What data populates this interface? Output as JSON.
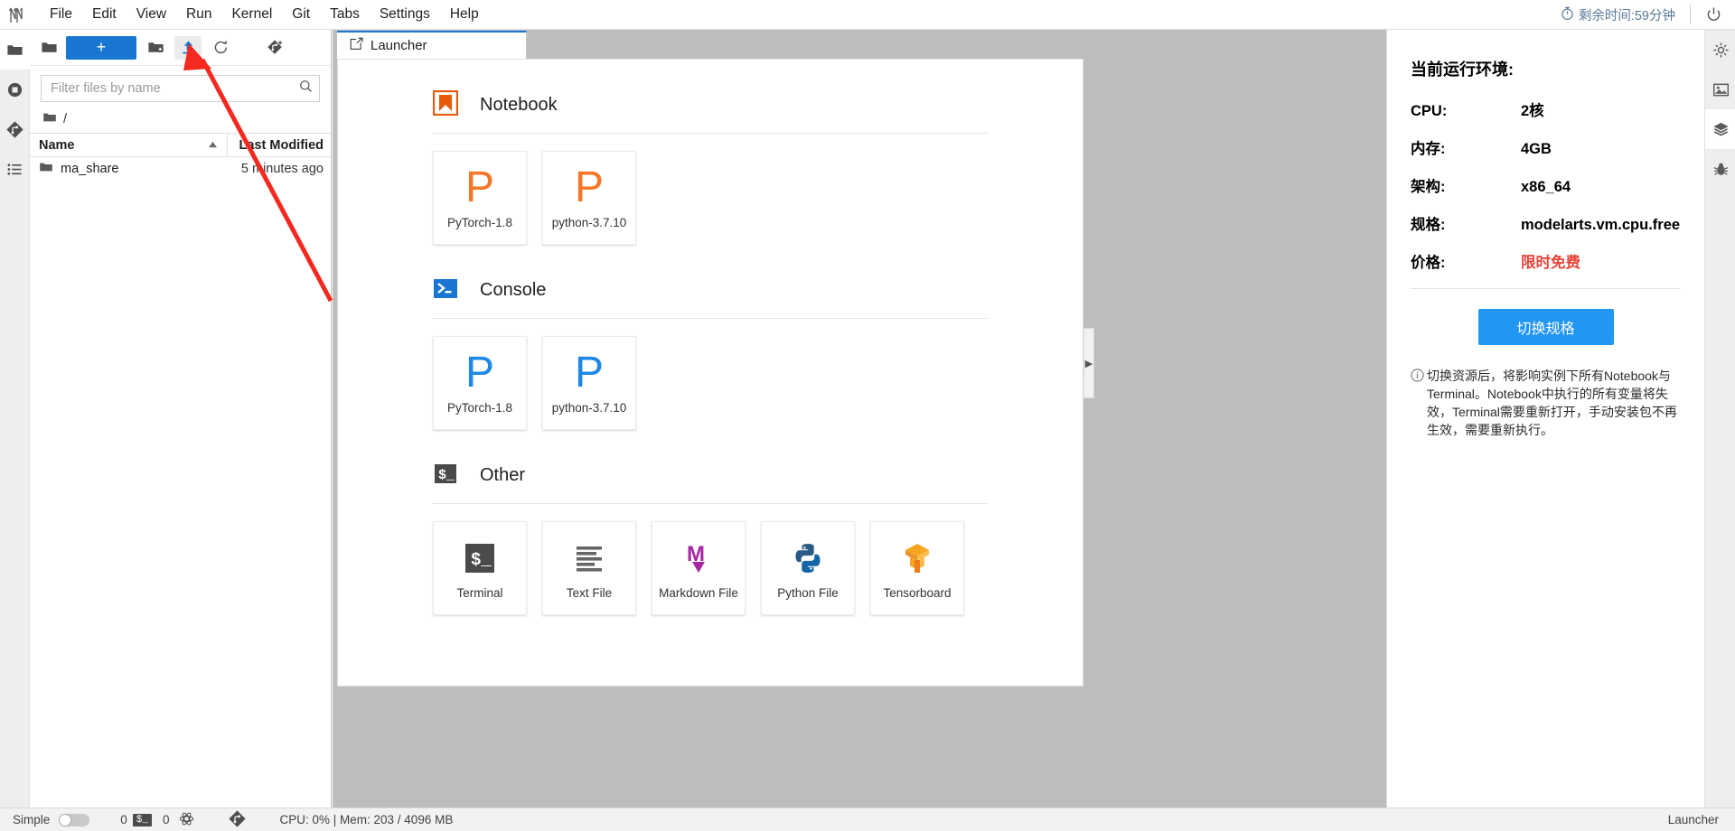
{
  "menubar": {
    "logo": "jupyter-logo",
    "items": [
      "File",
      "Edit",
      "View",
      "Run",
      "Kernel",
      "Git",
      "Tabs",
      "Settings",
      "Help"
    ],
    "timer_label": "剩余时间:59分钟",
    "timer_icon": "stopwatch-icon",
    "power_icon": "power-icon"
  },
  "activitybar": {
    "items": [
      {
        "name": "file-browser",
        "icon": "folder-icon",
        "active": true
      },
      {
        "name": "running-terminals",
        "icon": "stop-circle-icon",
        "active": false
      },
      {
        "name": "git-panel",
        "icon": "git-diamond-icon",
        "active": false
      },
      {
        "name": "table-of-contents",
        "icon": "list-icon",
        "active": false
      }
    ]
  },
  "filebrowser": {
    "toolbar": {
      "new_launcher_label": "+",
      "new_folder_icon": "new-folder-icon",
      "upload_icon": "upload-icon",
      "refresh_icon": "refresh-icon",
      "git_clone_icon": "git-clone-icon"
    },
    "filter_placeholder": "Filter files by name",
    "filter_value": "",
    "search_icon": "search-icon",
    "breadcrumb": "/",
    "breadcrumb_icon": "folder-icon",
    "columns": [
      "Name",
      "Last Modified"
    ],
    "sort_icon": "sort-ascending-icon",
    "rows": [
      {
        "icon": "folder-icon",
        "name": "ma_share",
        "modified": "5 minutes ago"
      }
    ]
  },
  "dock": {
    "tabs": [
      {
        "label": "Launcher",
        "icon": "launcher-icon",
        "active": true
      }
    ],
    "collapse_handle_icon": "chevron-right-icon"
  },
  "launcher": {
    "sections": [
      {
        "title": "Notebook",
        "icon": "notebook-bookmark-icon",
        "icon_color": "#e8590c",
        "cards": [
          {
            "label": "PyTorch-1.8",
            "icon": "kernel-P-icon",
            "color": "#f37726"
          },
          {
            "label": "python-3.7.10",
            "icon": "kernel-P-icon",
            "color": "#f37726"
          }
        ]
      },
      {
        "title": "Console",
        "icon": "console-prompt-icon",
        "icon_color": "#1976d2",
        "cards": [
          {
            "label": "PyTorch-1.8",
            "icon": "kernel-P-icon",
            "color": "#1e88e5"
          },
          {
            "label": "python-3.7.10",
            "icon": "kernel-P-icon",
            "color": "#1e88e5"
          }
        ]
      },
      {
        "title": "Other",
        "icon": "terminal-prompt-icon",
        "icon_color": "#4a4a4a",
        "cards": [
          {
            "label": "Terminal",
            "icon": "terminal-icon",
            "color": "#4a4a4a"
          },
          {
            "label": "Text File",
            "icon": "text-file-icon",
            "color": "#616161"
          },
          {
            "label": "Markdown File",
            "icon": "markdown-icon",
            "color": "#a626a4"
          },
          {
            "label": "Python File",
            "icon": "python-icon",
            "color": "#2b5b84"
          },
          {
            "label": "Tensorboard",
            "icon": "tensorboard-icon",
            "color": "#f6a623"
          }
        ]
      }
    ]
  },
  "rightpanel": {
    "title": "当前运行环境:",
    "rows": [
      {
        "key": "CPU:",
        "value": "2核",
        "highlight": false
      },
      {
        "key": "内存:",
        "value": "4GB",
        "highlight": false
      },
      {
        "key": "架构:",
        "value": "x86_64",
        "highlight": false
      },
      {
        "key": "规格:",
        "value": "modelarts.vm.cpu.free",
        "highlight": false
      },
      {
        "key": "价格:",
        "value": "限时免费",
        "highlight": true
      }
    ],
    "switch_button": "切换规格",
    "note_icon": "info-circle-icon",
    "note": "切换资源后，将影响实例下所有Notebook与Terminal。Notebook中执行的所有变量将失效，Terminal需要重新打开，手动安装包不再生效，需要重新执行。",
    "price_color": "#e8443a",
    "accent_color": "#2196f3"
  },
  "rightbar": {
    "items": [
      {
        "name": "property-inspector",
        "icon": "gear-sliders-icon",
        "active": false
      },
      {
        "name": "image-panel",
        "icon": "image-icon",
        "active": false
      },
      {
        "name": "extension-manager",
        "icon": "layers-icon",
        "active": true
      },
      {
        "name": "debugger",
        "icon": "bug-icon",
        "active": false
      }
    ]
  },
  "statusbar": {
    "simple_label": "Simple",
    "simple_toggle_on": false,
    "terminal_count": "0",
    "terminal_icon": "terminal-badge-icon",
    "kernel_count": "0",
    "kernel_icon": "kernel-circle-icon",
    "git_icon": "git-diamond-icon",
    "resource_text": "CPU: 0% | Mem: 203 / 4096 MB",
    "active_tab": "Launcher"
  },
  "annotation": {
    "type": "red-arrow",
    "color": "#f4291f",
    "points_to": "upload-icon"
  }
}
